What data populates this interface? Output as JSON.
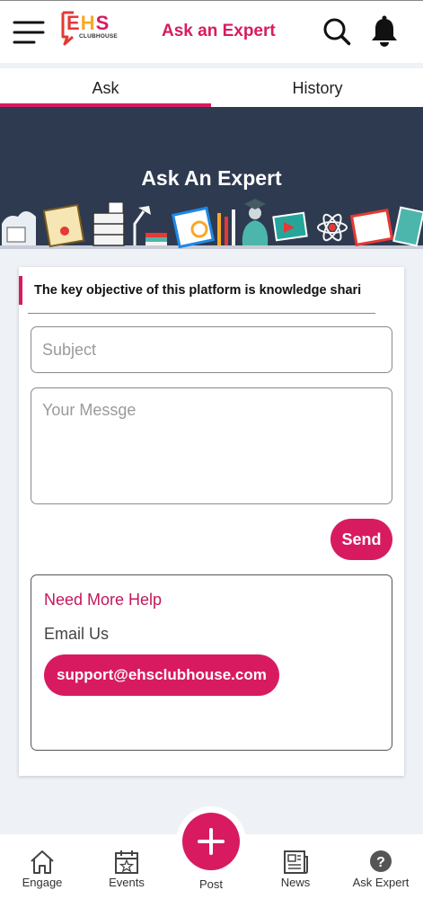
{
  "app": {
    "logo_text": "EHS",
    "logo_subtext": "CLUBHOUSE",
    "title": "Ask an Expert",
    "brand_color": "#d81b60"
  },
  "header": {
    "menu_icon": "hamburger-menu-icon",
    "search_icon": "search-icon",
    "notification_icon": "bell-icon"
  },
  "tabs": [
    {
      "label": "Ask",
      "active": true
    },
    {
      "label": "History",
      "active": false
    }
  ],
  "banner": {
    "title": "Ask An Expert",
    "background_color": "#2e3a50"
  },
  "form": {
    "objective_text": "The key objective of this platform is knowledge shari",
    "subject_placeholder": "Subject",
    "subject_value": "",
    "message_placeholder": "Your Messge",
    "message_value": "",
    "send_label": "Send"
  },
  "help": {
    "title": "Need More Help",
    "email_label": "Email Us",
    "email_address": "support@ehsclubhouse.com"
  },
  "bottom_nav": [
    {
      "label": "Engage",
      "icon": "home-icon"
    },
    {
      "label": "Events",
      "icon": "calendar-star-icon"
    },
    {
      "label": "Post",
      "icon": "plus-icon"
    },
    {
      "label": "News",
      "icon": "newspaper-icon"
    },
    {
      "label": "Ask Expert",
      "icon": "question-circle-icon"
    }
  ]
}
